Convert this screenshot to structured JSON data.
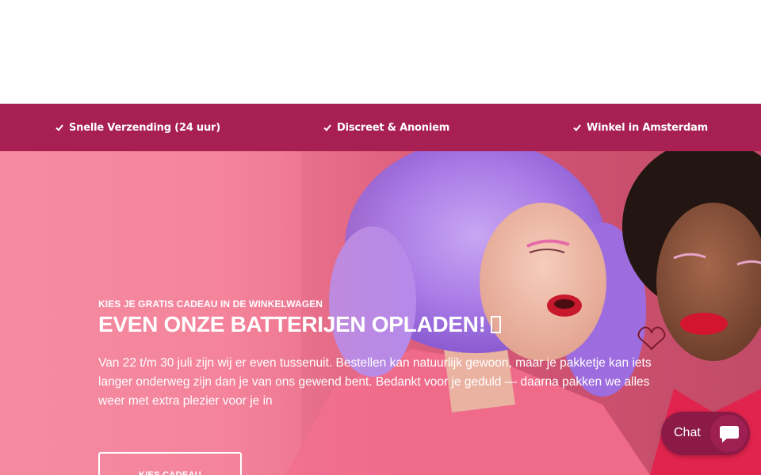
{
  "usp_bar": {
    "items": [
      {
        "label": "Snelle Verzending (24 uur)",
        "icon": "check-icon"
      },
      {
        "label": "Discreet & Anoniem",
        "icon": "check-icon"
      },
      {
        "label": "Winkel in Amsterdam",
        "icon": "check-icon"
      }
    ],
    "background": "#a81f53"
  },
  "hero": {
    "eyebrow": "KIES JE GRATIS CADEAU IN DE WINKELWAGEN",
    "title": "EVEN ONZE BATTERIJEN OPLADEN!",
    "title_icon": "missing-glyph-box",
    "body": "Van 22 t/m 30 juli zijn wij er even tussenuit. Bestellen kan natuurlijk gewoon, maar je pakketje kan iets langer onderweg zijn dan je van ons gewend bent. Bedankt voor je geduld — daarna pakken we alles weer met extra plezier voor je in",
    "button_label": "KIES CADEAU",
    "image_subject": "two-women-pink-background"
  },
  "chat": {
    "label": "Chat",
    "icon": "chat-bubble-icon",
    "color": "#8c1a46"
  }
}
